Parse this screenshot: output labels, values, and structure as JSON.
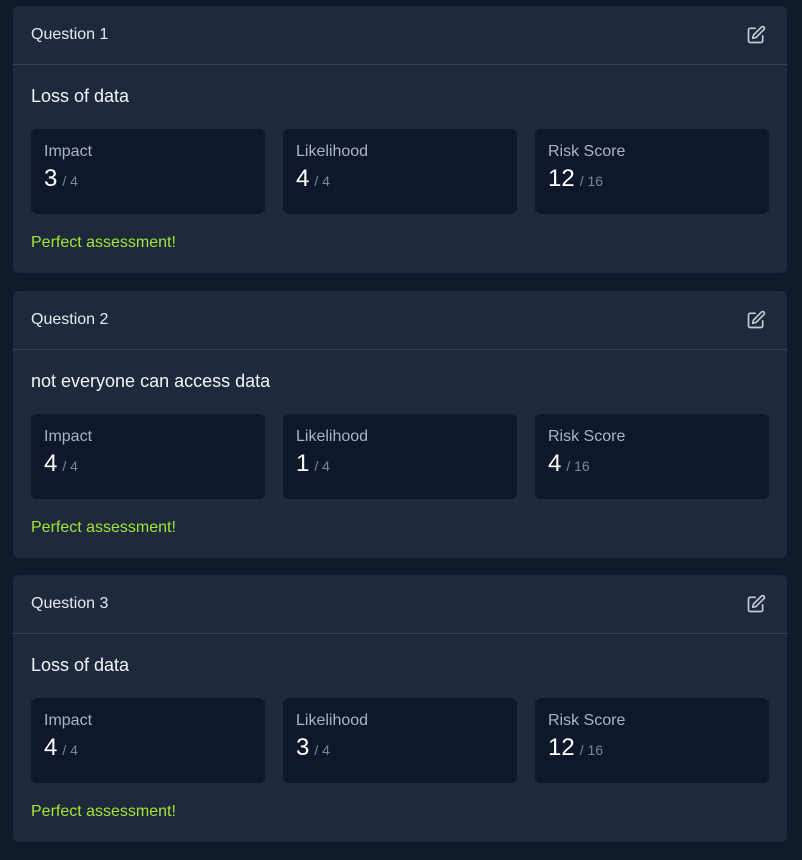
{
  "questions": [
    {
      "title": "Question 1",
      "text": "Loss of data",
      "metrics": {
        "impact": {
          "label": "Impact",
          "value": "3",
          "max": "/ 4"
        },
        "likelihood": {
          "label": "Likelihood",
          "value": "4",
          "max": "/ 4"
        },
        "risk": {
          "label": "Risk Score",
          "value": "12",
          "max": "/ 16"
        }
      },
      "feedback": "Perfect assessment!"
    },
    {
      "title": "Question 2",
      "text": "not everyone can access data",
      "metrics": {
        "impact": {
          "label": "Impact",
          "value": "4",
          "max": "/ 4"
        },
        "likelihood": {
          "label": "Likelihood",
          "value": "1",
          "max": "/ 4"
        },
        "risk": {
          "label": "Risk Score",
          "value": "4",
          "max": "/ 16"
        }
      },
      "feedback": "Perfect assessment!"
    },
    {
      "title": "Question 3",
      "text": "Loss of data",
      "metrics": {
        "impact": {
          "label": "Impact",
          "value": "4",
          "max": "/ 4"
        },
        "likelihood": {
          "label": "Likelihood",
          "value": "3",
          "max": "/ 4"
        },
        "risk": {
          "label": "Risk Score",
          "value": "12",
          "max": "/ 16"
        }
      },
      "feedback": "Perfect assessment!"
    }
  ],
  "icons": {
    "edit": "edit-icon"
  },
  "colors": {
    "background": "#111a2b",
    "card": "#1e293b",
    "metric_box": "#0f172a",
    "feedback": "#a3e635"
  }
}
